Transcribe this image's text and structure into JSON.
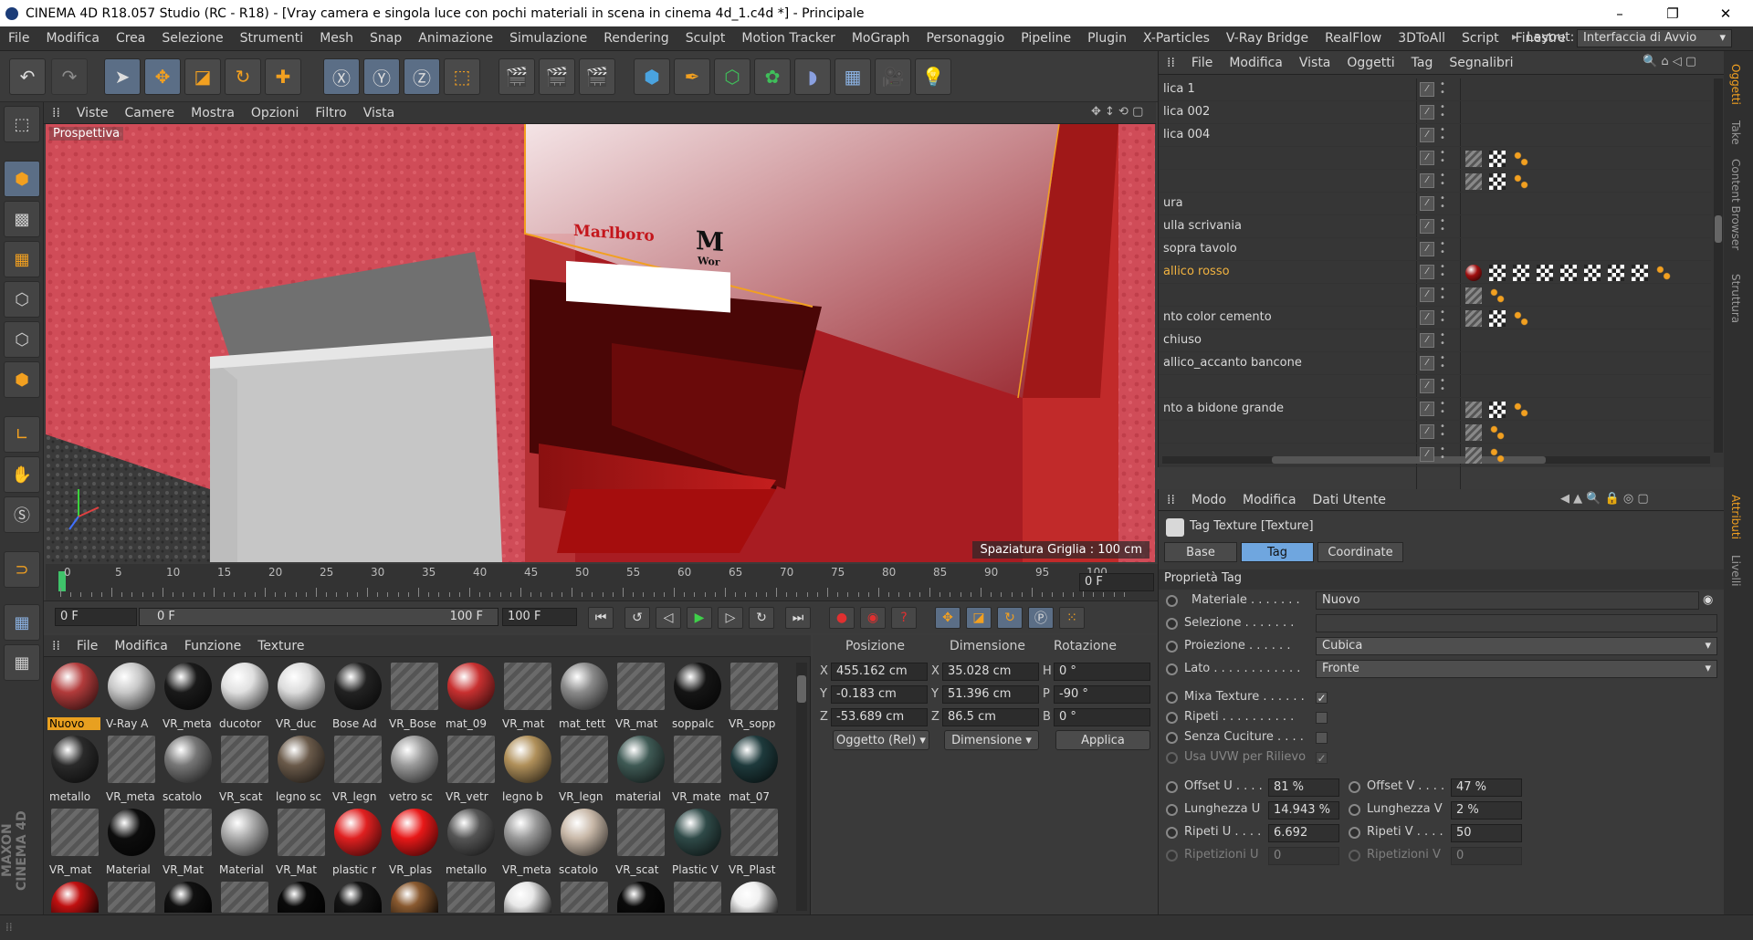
{
  "window": {
    "title": "CINEMA 4D R18.057 Studio (RC - R18) - [Vray camera e singola luce con pochi materiali in scena in cinema 4d_1.c4d *] - Principale",
    "minimize": "–",
    "restore": "❐",
    "close": "✕"
  },
  "menu": [
    "File",
    "Modifica",
    "Crea",
    "Selezione",
    "Strumenti",
    "Mesh",
    "Snap",
    "Animazione",
    "Simulazione",
    "Rendering",
    "Sculpt",
    "Motion Tracker",
    "MoGraph",
    "Personaggio",
    "Pipeline",
    "Plugin",
    "X-Particles",
    "V-Ray Bridge",
    "RealFlow",
    "3DToAll",
    "Script",
    "Finestre"
  ],
  "layout": {
    "label": "Layout:",
    "value": "Interfaccia di Avvio"
  },
  "viewport": {
    "menu": [
      "Viste",
      "Camere",
      "Mostra",
      "Opzioni",
      "Filtro",
      "Vista"
    ],
    "label": "Prospettiva",
    "grid": "Spaziatura Griglia : 100 cm",
    "logo_text1": "Marlboro",
    "logo_text2": "M",
    "logo_text3": "Wor"
  },
  "timeline": {
    "ticks": [
      "0",
      "5",
      "10",
      "15",
      "20",
      "25",
      "30",
      "35",
      "40",
      "45",
      "50",
      "55",
      "60",
      "65",
      "70",
      "75",
      "80",
      "85",
      "90",
      "95",
      "100"
    ],
    "current": "0 F"
  },
  "transport": {
    "start": "0 F",
    "range_start": "0 F",
    "range_end": "100 F",
    "end": "100 F"
  },
  "materials": {
    "menu": [
      "File",
      "Modifica",
      "Funzione",
      "Texture"
    ],
    "items": [
      {
        "name": "Nuovo",
        "color": "#b23b3b",
        "sel": true
      },
      {
        "name": "V-Ray A",
        "color": "#c8c8c8"
      },
      {
        "name": "VR_meta",
        "color": "#1a1a1a"
      },
      {
        "name": "ducotor",
        "color": "#e0e0e0"
      },
      {
        "name": "VR_duc",
        "color": "#dcdcdc"
      },
      {
        "name": "Bose Ad",
        "color": "#222"
      },
      {
        "name": "VR_Bose",
        "color": "stripe"
      },
      {
        "name": "mat_09",
        "color": "#c83030"
      },
      {
        "name": "VR_mat",
        "color": "stripe"
      },
      {
        "name": "mat_tett",
        "color": "#8a8a8a"
      },
      {
        "name": "VR_mat",
        "color": "stripe"
      },
      {
        "name": "soppalc",
        "color": "#151515"
      },
      {
        "name": "VR_sopp",
        "color": "stripe"
      },
      {
        "name": "metallo",
        "color": "#2a2a2a"
      },
      {
        "name": "VR_meta",
        "color": "stripe"
      },
      {
        "name": "scatolo",
        "color": "#777"
      },
      {
        "name": "VR_scat",
        "color": "stripe"
      },
      {
        "name": "legno sc",
        "color": "#6a5a4a"
      },
      {
        "name": "VR_legn",
        "color": "stripe"
      },
      {
        "name": "vetro sc",
        "color": "#9a9a9a"
      },
      {
        "name": "VR_vetr",
        "color": "stripe"
      },
      {
        "name": "legno b",
        "color": "#b0905a"
      },
      {
        "name": "VR_legn",
        "color": "stripe"
      },
      {
        "name": "material",
        "color": "#3f5a55"
      },
      {
        "name": "VR_mate",
        "color": "stripe"
      },
      {
        "name": "mat_07",
        "color": "#1e3a3c"
      },
      {
        "name": "VR_mat",
        "color": "stripe"
      },
      {
        "name": "Material",
        "color": "#0d0d0d"
      },
      {
        "name": "VR_Mat",
        "color": "stripe"
      },
      {
        "name": "Material",
        "color": "#aaaaaa"
      },
      {
        "name": "VR_Mat",
        "color": "stripe"
      },
      {
        "name": "plastic r",
        "color": "#e02020"
      },
      {
        "name": "VR_plas",
        "color": "#e81818"
      },
      {
        "name": "metallo",
        "color": "#555"
      },
      {
        "name": "VR_meta",
        "color": "#999"
      },
      {
        "name": "scatolo",
        "color": "#c8b8a8"
      },
      {
        "name": "VR_scat",
        "color": "stripe"
      },
      {
        "name": "Plastic V",
        "color": "#2f4a48"
      },
      {
        "name": "VR_Plast",
        "color": "stripe"
      }
    ]
  },
  "coords": {
    "headers": [
      "Posizione",
      "Dimensione",
      "Rotazione"
    ],
    "rows": [
      {
        "axis": "X",
        "pos": "455.162 cm",
        "dimaxis": "X",
        "dim": "35.028 cm",
        "rotaxis": "H",
        "rot": "0 °"
      },
      {
        "axis": "Y",
        "pos": "-0.183 cm",
        "dimaxis": "Y",
        "dim": "51.396 cm",
        "rotaxis": "P",
        "rot": "-90 °"
      },
      {
        "axis": "Z",
        "pos": "-53.689 cm",
        "dimaxis": "Z",
        "dim": "86.5 cm",
        "rotaxis": "B",
        "rot": "0 °"
      }
    ],
    "mode": "Oggetto (Rel)",
    "size": "Dimensione",
    "apply": "Applica"
  },
  "objects": {
    "menu": [
      "File",
      "Modifica",
      "Vista",
      "Oggetti",
      "Tag",
      "Segnalibri"
    ],
    "rows": [
      {
        "name": "lica 1",
        "tags": 0
      },
      {
        "name": "lica 002",
        "tags": 0
      },
      {
        "name": "lica 004",
        "tags": 0
      },
      {
        "name": "",
        "tags": 3
      },
      {
        "name": "",
        "tags": 3
      },
      {
        "name": "ura",
        "tags": 0
      },
      {
        "name": "ulla scrivania",
        "tags": 0
      },
      {
        "name": "sopra tavolo",
        "tags": 0
      },
      {
        "name": "allico rosso",
        "tags": 9,
        "hl": true
      },
      {
        "name": "",
        "tags": 2
      },
      {
        "name": "nto color cemento",
        "tags": 3
      },
      {
        "name": "chiuso",
        "tags": 0
      },
      {
        "name": "allico_accanto bancone",
        "tags": 0
      },
      {
        "name": "",
        "tags": 0
      },
      {
        "name": "nto a bidone grande",
        "tags": 3
      },
      {
        "name": "",
        "tags": 2
      },
      {
        "name": "",
        "tags": 2
      }
    ]
  },
  "attributes": {
    "menu": [
      "Modo",
      "Modifica",
      "Dati Utente"
    ],
    "title": "Tag Texture [Texture]",
    "tabs": [
      "Base",
      "Tag",
      "Coordinate"
    ],
    "section": "Proprietà Tag",
    "materiale_label": "Materiale . . . . . . .",
    "materiale": "Nuovo",
    "selezione_label": "Selezione . . . . . . .",
    "proiezione_label": "Proiezione . . . . . .",
    "proiezione": "Cubica",
    "lato_label": "Lato . . . . . . . . . . . .",
    "lato": "Fronte",
    "mixa": "Mixa Texture . . . . . .",
    "ripeti": "Ripeti . . . . . . . . . .",
    "senza": "Senza Cuciture . . . .",
    "uvw": "Usa UVW per Rilievo",
    "offu_label": "Offset U . . . .",
    "offu": "81 %",
    "offv_label": "Offset V . . . .",
    "offv": "47 %",
    "lenu_label": "Lunghezza U",
    "lenu": "14.943 %",
    "lenv_label": "Lunghezza V",
    "lenv": "2 %",
    "repu_label": "Ripeti U . . . .",
    "repu": "6.692",
    "repv_label": "Ripeti V . . . .",
    "repv": "50",
    "ripu_label": "Ripetizioni U",
    "ripu": "0",
    "ripv_label": "Ripetizioni V",
    "ripv": "0"
  },
  "sidetabs": [
    "Oggetti",
    "Take",
    "Content Browser",
    "Struttura"
  ],
  "sidetabs2": [
    "Attributi",
    "Livelli"
  ],
  "maxon": "MAXON CINEMA 4D"
}
